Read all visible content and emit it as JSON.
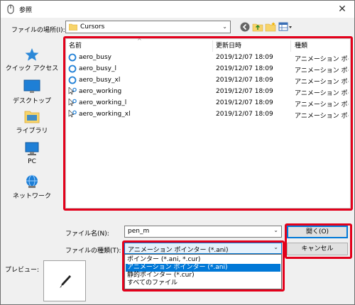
{
  "window": {
    "title": "参照",
    "close_glyph": "✕"
  },
  "location": {
    "label": "ファイルの場所(I):",
    "value": "Cursors"
  },
  "places": [
    {
      "label": "クイック アクセス",
      "icon": "star-icon"
    },
    {
      "label": "デスクトップ",
      "icon": "desktop-icon"
    },
    {
      "label": "ライブラリ",
      "icon": "library-icon"
    },
    {
      "label": "PC",
      "icon": "pc-icon"
    },
    {
      "label": "ネットワーク",
      "icon": "network-icon"
    }
  ],
  "columns": {
    "name": "名前",
    "date": "更新日時",
    "type": "種類"
  },
  "files": [
    {
      "name": "aero_busy",
      "date": "2019/12/07 18:09",
      "type": "アニメーション ポインター",
      "icon": "busy-cursor-icon"
    },
    {
      "name": "aero_busy_l",
      "date": "2019/12/07 18:09",
      "type": "アニメーション ポインター",
      "icon": "busy-cursor-icon"
    },
    {
      "name": "aero_busy_xl",
      "date": "2019/12/07 18:09",
      "type": "アニメーション ポインター",
      "icon": "busy-cursor-icon"
    },
    {
      "name": "aero_working",
      "date": "2019/12/07 18:09",
      "type": "アニメーション ポインター",
      "icon": "working-cursor-icon"
    },
    {
      "name": "aero_working_l",
      "date": "2019/12/07 18:09",
      "type": "アニメーション ポインター",
      "icon": "working-cursor-icon"
    },
    {
      "name": "aero_working_xl",
      "date": "2019/12/07 18:09",
      "type": "アニメーション ポインター",
      "icon": "working-cursor-icon"
    }
  ],
  "filename": {
    "label": "ファイル名(N):",
    "value": "pen_m"
  },
  "filetype": {
    "label": "ファイルの種類(T):",
    "value": "アニメーション ポインター (*.ani)",
    "options": [
      "ポインター (*.ani, *.cur)",
      "アニメーション ポインター (*.ani)",
      "静的ポインター (*.cur)",
      "すべてのファイル"
    ],
    "selected_index": 1
  },
  "buttons": {
    "open": "開く(O)",
    "cancel": "キャンセル"
  },
  "preview": {
    "label": "プレビュー:"
  },
  "colors": {
    "highlight_border": "#e3001b",
    "selection": "#0078d7"
  }
}
